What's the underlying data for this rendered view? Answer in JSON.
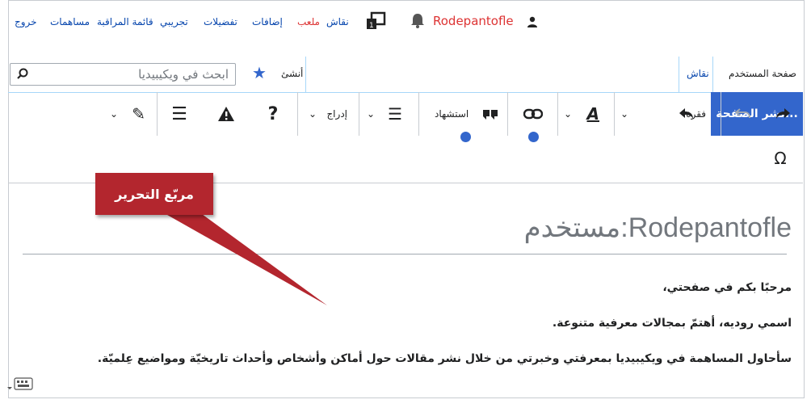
{
  "personal_bar": {
    "username": "Rodepantofle",
    "links": [
      {
        "label": "نقاش",
        "x": "nq"
      },
      {
        "label": "ملعب"
      },
      {
        "label": "إضافات"
      },
      {
        "label": "تفضيلات"
      },
      {
        "label": "تجريبي"
      },
      {
        "label": "قائمة المراقبة"
      },
      {
        "label": "مساهمات"
      },
      {
        "label": "خروج"
      }
    ]
  },
  "tabs": {
    "user_page": "صفحة المستخدم",
    "talk": "نقاش",
    "create": "أنشئ",
    "search_placeholder": "ابحث في ويكيبيديا"
  },
  "toolbar": {
    "paragraph": "فقرة",
    "cite": "استشهاد",
    "insert": "إدراج",
    "publish": "نشر الصفحة...",
    "special_char": "Ω"
  },
  "callout": {
    "label": "مربّع التحرير"
  },
  "content": {
    "title": "مستخدم:Rodepantofle",
    "paragraphs": [
      "مرحبًا بكم في صفحتي،",
      "اسمي روديه، أهتمّ بمجالات معرفية متنوعة.",
      "سأحاول المساهمة في ويكيبيديا بمعرفتي وخبرتي من خلال نشر مقالات حول أماكن وأشخاص وأحداث تاريخيّة ومواضيع عِلميّة."
    ]
  },
  "colors": {
    "accent": "#3366cc",
    "callout": "#b3262e",
    "link": "#0645ad",
    "redlink": "#dd3333"
  }
}
